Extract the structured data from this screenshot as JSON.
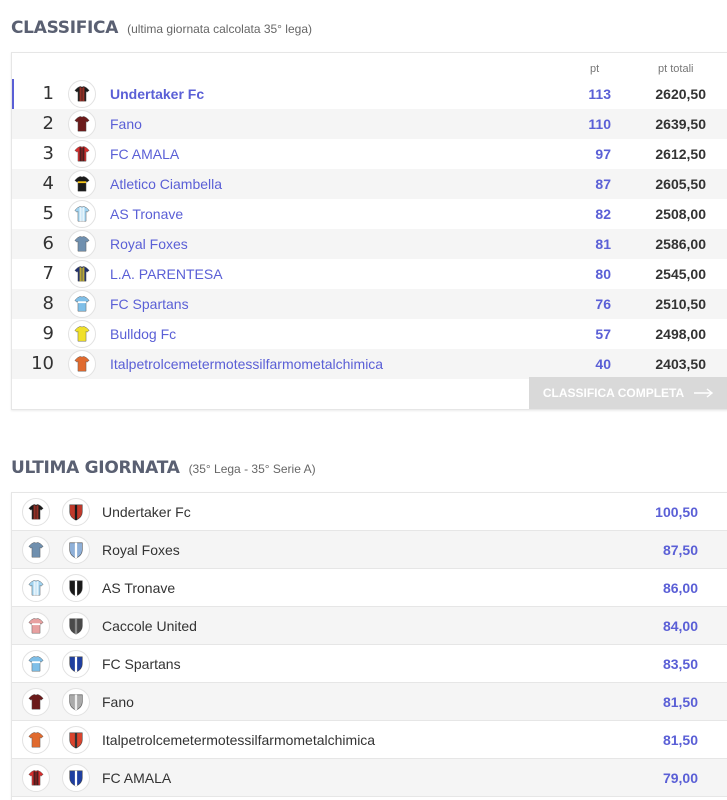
{
  "standings": {
    "title": "CLASSIFICA",
    "subtitle": "(ultima giornata calcolata 35° lega)",
    "col_pt": "pt",
    "col_total": "pt totali",
    "button_label": "CLASSIFICA COMPLETA",
    "rows": [
      {
        "rank": "1",
        "team": "Undertaker Fc",
        "pt": "113",
        "total": "2620,50",
        "jersey": {
          "c1": "#1a1a1a",
          "c2": "#c0392b",
          "pattern": "stripes"
        }
      },
      {
        "rank": "2",
        "team": "Fano",
        "pt": "110",
        "total": "2639,50",
        "jersey": {
          "c1": "#6b1a1a",
          "c2": "#6b1a1a",
          "pattern": "solid"
        }
      },
      {
        "rank": "3",
        "team": "FC AMALA",
        "pt": "97",
        "total": "2612,50",
        "jersey": {
          "c1": "#d62c2c",
          "c2": "#1a1a1a",
          "pattern": "stripes"
        }
      },
      {
        "rank": "4",
        "team": "Atletico Ciambella",
        "pt": "87",
        "total": "2605,50",
        "jersey": {
          "c1": "#1a1a1a",
          "c2": "#f5c518",
          "pattern": "yoke"
        }
      },
      {
        "rank": "5",
        "team": "AS Tronave",
        "pt": "82",
        "total": "2508,00",
        "jersey": {
          "c1": "#9fd2f0",
          "c2": "#ffffff",
          "pattern": "stripes"
        }
      },
      {
        "rank": "6",
        "team": "Royal Foxes",
        "pt": "81",
        "total": "2586,00",
        "jersey": {
          "c1": "#6f8fae",
          "c2": "#6f8fae",
          "pattern": "solid"
        }
      },
      {
        "rank": "7",
        "team": "L.A. PARENTESA",
        "pt": "80",
        "total": "2545,00",
        "jersey": {
          "c1": "#1f2f6f",
          "c2": "#f1d21f",
          "pattern": "stripes"
        }
      },
      {
        "rank": "8",
        "team": "FC Spartans",
        "pt": "76",
        "total": "2510,50",
        "jersey": {
          "c1": "#7fbfe8",
          "c2": "#ffffff",
          "pattern": "yoke"
        }
      },
      {
        "rank": "9",
        "team": "Bulldog Fc",
        "pt": "57",
        "total": "2498,00",
        "jersey": {
          "c1": "#f0e02a",
          "c2": "#f0e02a",
          "pattern": "solid"
        }
      },
      {
        "rank": "10",
        "team": "Italpetrolcemetermotessilfarmometalchimica",
        "pt": "40",
        "total": "2403,50",
        "jersey": {
          "c1": "#e06a2e",
          "c2": "#e06a2e",
          "pattern": "solid"
        }
      }
    ]
  },
  "matchday": {
    "title": "ULTIMA GIORNATA",
    "subtitle": "(35° Lega - 35° Serie A)",
    "rows": [
      {
        "team": "Undertaker Fc",
        "score": "100,50",
        "jersey": {
          "c1": "#1a1a1a",
          "c2": "#c0392b",
          "pattern": "stripes"
        },
        "crest": {
          "c1": "#c0392b",
          "c2": "#1a1a1a"
        }
      },
      {
        "team": "Royal Foxes",
        "score": "87,50",
        "jersey": {
          "c1": "#6f8fae",
          "c2": "#6f8fae",
          "pattern": "solid"
        },
        "crest": {
          "c1": "#8fb0d8",
          "c2": "#ffffff"
        }
      },
      {
        "team": "AS Tronave",
        "score": "86,00",
        "jersey": {
          "c1": "#9fd2f0",
          "c2": "#ffffff",
          "pattern": "stripes"
        },
        "crest": {
          "c1": "#1a1a1a",
          "c2": "#ffffff"
        }
      },
      {
        "team": "Caccole United",
        "score": "84,00",
        "jersey": {
          "c1": "#e8a0a0",
          "c2": "#ffffff",
          "pattern": "yoke"
        },
        "crest": {
          "c1": "#4a4a4a",
          "c2": "#8a8a8a"
        }
      },
      {
        "team": "FC Spartans",
        "score": "83,50",
        "jersey": {
          "c1": "#7fbfe8",
          "c2": "#ffffff",
          "pattern": "yoke"
        },
        "crest": {
          "c1": "#1f3fa0",
          "c2": "#ffffff"
        }
      },
      {
        "team": "Fano",
        "score": "81,50",
        "jersey": {
          "c1": "#6b1a1a",
          "c2": "#6b1a1a",
          "pattern": "solid"
        },
        "crest": {
          "c1": "#aaaaaa",
          "c2": "#eeeeee"
        }
      },
      {
        "team": "Italpetrolcemetermotessilfarmometalchimica",
        "score": "81,50",
        "jersey": {
          "c1": "#e06a2e",
          "c2": "#e06a2e",
          "pattern": "solid"
        },
        "crest": {
          "c1": "#d9442e",
          "c2": "#333333"
        }
      },
      {
        "team": "FC AMALA",
        "score": "79,00",
        "jersey": {
          "c1": "#d62c2c",
          "c2": "#1a1a1a",
          "pattern": "stripes"
        },
        "crest": {
          "c1": "#1f3fa0",
          "c2": "#ffffff"
        }
      }
    ]
  }
}
